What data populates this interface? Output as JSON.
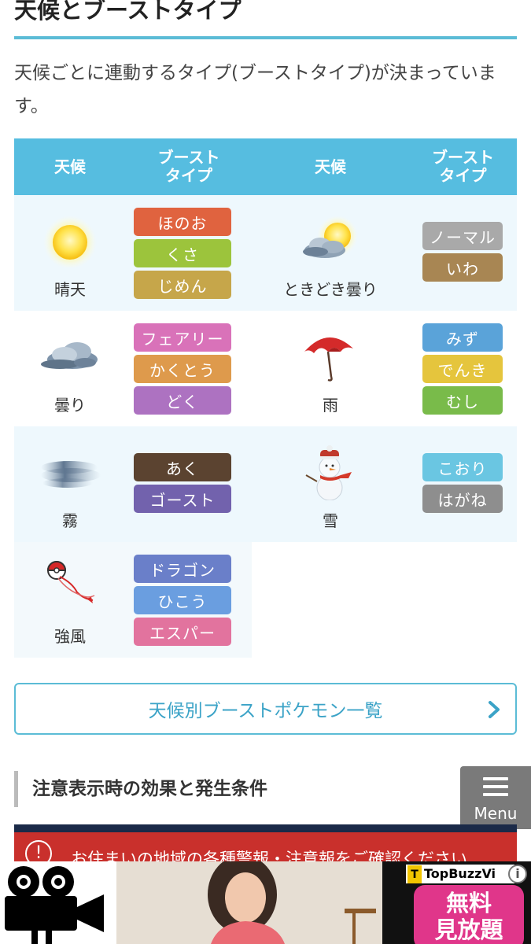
{
  "section_title": "天候とブーストタイプ",
  "intro_text": "天候ごとに連動するタイプ(ブーストタイプ)が決まっています。",
  "table": {
    "headers": [
      "天候",
      "ブースト\nタイプ",
      "天候",
      "ブースト\nタイプ"
    ],
    "rows": [
      {
        "left": {
          "weather": "晴天",
          "icon": "sunny-icon",
          "types": [
            "ほのお",
            "くさ",
            "じめん"
          ]
        },
        "right": {
          "weather": "ときどき曇り",
          "icon": "partly-cloudy-icon",
          "types": [
            "ノーマル",
            "いわ"
          ]
        }
      },
      {
        "left": {
          "weather": "曇り",
          "icon": "cloudy-icon",
          "types": [
            "フェアリー",
            "かくとう",
            "どく"
          ]
        },
        "right": {
          "weather": "雨",
          "icon": "umbrella-icon",
          "types": [
            "みず",
            "でんき",
            "むし"
          ]
        }
      },
      {
        "left": {
          "weather": "霧",
          "icon": "fog-icon",
          "types": [
            "あく",
            "ゴースト"
          ]
        },
        "right": {
          "weather": "雪",
          "icon": "snowman-icon",
          "types": [
            "こおり",
            "はがね"
          ]
        }
      },
      {
        "left": {
          "weather": "強風",
          "icon": "kite-icon",
          "types": [
            "ドラゴン",
            "ひこう",
            "エスパー"
          ]
        }
      }
    ]
  },
  "type_colors": {
    "ほのお": "#e0633f",
    "くさ": "#9cc43c",
    "じめん": "#c6a64a",
    "ノーマル": "#a9a9a9",
    "いわ": "#a88653",
    "フェアリー": "#d972b9",
    "かくとう": "#de9a4c",
    "どく": "#ad72c1",
    "みず": "#5aa3d9",
    "でんき": "#e5c53d",
    "むし": "#79bb4a",
    "あく": "#5b4330",
    "ゴースト": "#7262ad",
    "こおり": "#6ac6e2",
    "はがね": "#8e8e8e",
    "ドラゴン": "#6a7fc9",
    "ひこう": "#6a9ee0",
    "エスパー": "#e2739e"
  },
  "link_button": {
    "label": "天候別ブーストポケモン一覧"
  },
  "section2_title": "注意表示時の効果と発生条件",
  "menu_button": {
    "label": "Menu"
  },
  "alert_banner": {
    "icon_text": "!",
    "text": "お住まいの地域の各種警報・注意報をご確認ください"
  },
  "ad": {
    "brand": "TopBuzzVi",
    "badge_line1": "無料",
    "badge_line2": "見放題",
    "info_icon": "i"
  }
}
